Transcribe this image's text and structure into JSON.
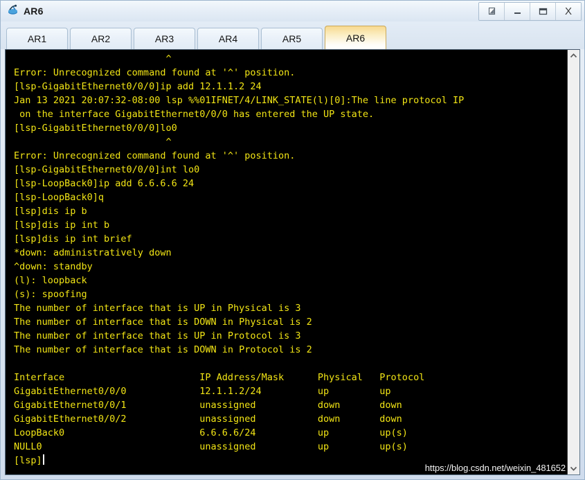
{
  "window": {
    "title": "AR6",
    "icon": "router-icon",
    "controls": [
      {
        "name": "restore-cascade-button",
        "glyph": "cascade"
      },
      {
        "name": "minimize-button",
        "glyph": "minimize"
      },
      {
        "name": "maximize-button",
        "glyph": "maximize"
      },
      {
        "name": "close-button",
        "glyph": "X"
      }
    ],
    "close_label": "X"
  },
  "tabs": {
    "items": [
      {
        "label": "AR1",
        "active": false
      },
      {
        "label": "AR2",
        "active": false
      },
      {
        "label": "AR3",
        "active": false
      },
      {
        "label": "AR4",
        "active": false
      },
      {
        "label": "AR5",
        "active": false
      },
      {
        "label": "AR6",
        "active": true
      }
    ],
    "active_label": "AR6"
  },
  "terminal": {
    "foreground_color": "#f2e515",
    "background_color": "#000000",
    "cursor_visible": true,
    "lines": [
      "                           ^",
      "Error: Unrecognized command found at '^' position.",
      "[lsp-GigabitEthernet0/0/0]ip add 12.1.1.2 24",
      "Jan 13 2021 20:07:32-08:00 lsp %%01IFNET/4/LINK_STATE(l)[0]:The line protocol IP",
      " on the interface GigabitEthernet0/0/0 has entered the UP state.",
      "[lsp-GigabitEthernet0/0/0]lo0",
      "                           ^",
      "Error: Unrecognized command found at '^' position.",
      "[lsp-GigabitEthernet0/0/0]int lo0",
      "[lsp-LoopBack0]ip add 6.6.6.6 24",
      "[lsp-LoopBack0]q",
      "[lsp]dis ip b",
      "[lsp]dis ip int b",
      "[lsp]dis ip int brief",
      "*down: administratively down",
      "^down: standby",
      "(l): loopback",
      "(s): spoofing",
      "The number of interface that is UP in Physical is 3",
      "The number of interface that is DOWN in Physical is 2",
      "The number of interface that is UP in Protocol is 3",
      "The number of interface that is DOWN in Protocol is 2",
      "",
      "Interface                        IP Address/Mask      Physical   Protocol",
      "GigabitEthernet0/0/0             12.1.1.2/24          up         up",
      "GigabitEthernet0/0/1             unassigned           down       down",
      "GigabitEthernet0/0/2             unassigned           down       down",
      "LoopBack0                        6.6.6.6/24           up         up(s)",
      "NULL0                            unassigned           up         up(s)"
    ],
    "prompt": "[lsp]",
    "interface_table": {
      "columns": [
        "Interface",
        "IP Address/Mask",
        "Physical",
        "Protocol"
      ],
      "rows": [
        [
          "GigabitEthernet0/0/0",
          "12.1.1.2/24",
          "up",
          "up"
        ],
        [
          "GigabitEthernet0/0/1",
          "unassigned",
          "down",
          "down"
        ],
        [
          "GigabitEthernet0/0/2",
          "unassigned",
          "down",
          "down"
        ],
        [
          "LoopBack0",
          "6.6.6.6/24",
          "up",
          "up(s)"
        ],
        [
          "NULL0",
          "unassigned",
          "up",
          "up(s)"
        ]
      ]
    },
    "counters": {
      "up_physical": "3",
      "down_physical": "2",
      "up_protocol": "3",
      "down_protocol": "2"
    },
    "legend": [
      "*down: administratively down",
      "^down: standby",
      "(l): loopback",
      "(s): spoofing"
    ]
  },
  "watermark": {
    "text": "https://blog.csdn.net/weixin_481652"
  },
  "scrollbar": {
    "up_arrow": "chevron-up-icon",
    "down_arrow": "chevron-down-icon"
  }
}
